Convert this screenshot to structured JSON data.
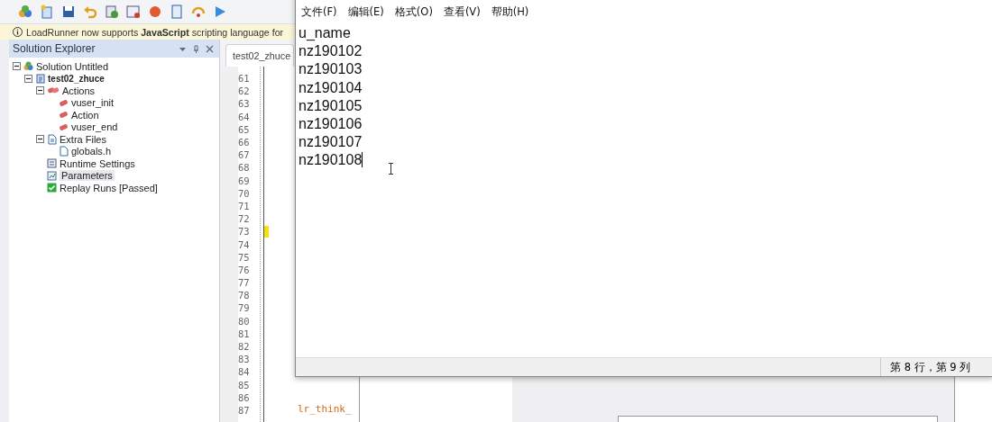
{
  "info_bar": {
    "text": "LoadRunner now supports **JavaScript** scripting language for"
  },
  "solution_explorer": {
    "title": "Solution Explorer",
    "tree": [
      {
        "label": "Solution Untitled",
        "kind": "solution",
        "expanded": true,
        "selected": false,
        "children": [
          {
            "label": "test02_zhuce",
            "kind": "script",
            "expanded": true,
            "selected": false,
            "children": [
              {
                "label": "Actions",
                "kind": "actions",
                "expanded": true,
                "selected": false,
                "children": [
                  {
                    "label": "vuser_init",
                    "kind": "action",
                    "selected": false
                  },
                  {
                    "label": "Action",
                    "kind": "action",
                    "selected": false
                  },
                  {
                    "label": "vuser_end",
                    "kind": "action",
                    "selected": false
                  }
                ]
              },
              {
                "label": "Extra Files",
                "kind": "files",
                "expanded": true,
                "selected": false,
                "children": [
                  {
                    "label": "globals.h",
                    "kind": "file",
                    "selected": false
                  }
                ]
              },
              {
                "label": "Runtime Settings",
                "kind": "settings",
                "selected": false
              },
              {
                "label": "Parameters",
                "kind": "parameters",
                "selected": true
              },
              {
                "label": "Replay Runs [Passed]",
                "kind": "replay",
                "selected": false
              }
            ]
          }
        ]
      }
    ]
  },
  "editor": {
    "tab": "test02_zhuce",
    "lines": [
      {
        "number": "61",
        "marked": false
      },
      {
        "number": "62",
        "marked": false
      },
      {
        "number": "63",
        "marked": false
      },
      {
        "number": "64",
        "marked": false
      },
      {
        "number": "65",
        "marked": false
      },
      {
        "number": "66",
        "marked": false
      },
      {
        "number": "67",
        "marked": false
      },
      {
        "number": "68",
        "marked": false
      },
      {
        "number": "69",
        "marked": false
      },
      {
        "number": "70",
        "marked": false
      },
      {
        "number": "71",
        "marked": false
      },
      {
        "number": "72",
        "marked": false
      },
      {
        "number": "73",
        "marked": true
      },
      {
        "number": "74",
        "marked": false
      },
      {
        "number": "75",
        "marked": false
      },
      {
        "number": "76",
        "marked": false
      },
      {
        "number": "77",
        "marked": false
      },
      {
        "number": "78",
        "marked": false
      },
      {
        "number": "79",
        "marked": false
      },
      {
        "number": "80",
        "marked": false
      },
      {
        "number": "81",
        "marked": false
      },
      {
        "number": "82",
        "marked": false
      },
      {
        "number": "83",
        "marked": false
      },
      {
        "number": "84",
        "marked": false
      },
      {
        "number": "85",
        "marked": false
      },
      {
        "number": "86",
        "marked": false
      },
      {
        "number": "87",
        "marked": false
      }
    ],
    "code_fragment": "lr_think_"
  },
  "notepad": {
    "menu": [
      "文件(F)",
      "编辑(E)",
      "格式(O)",
      "查看(V)",
      "帮助(H)"
    ],
    "lines": [
      "u_name",
      "nz190102",
      "nz190103",
      "nz190104",
      "nz190105",
      "nz190106",
      "nz190107",
      "nz190108"
    ],
    "status": "第 8 行，第 9 列"
  }
}
